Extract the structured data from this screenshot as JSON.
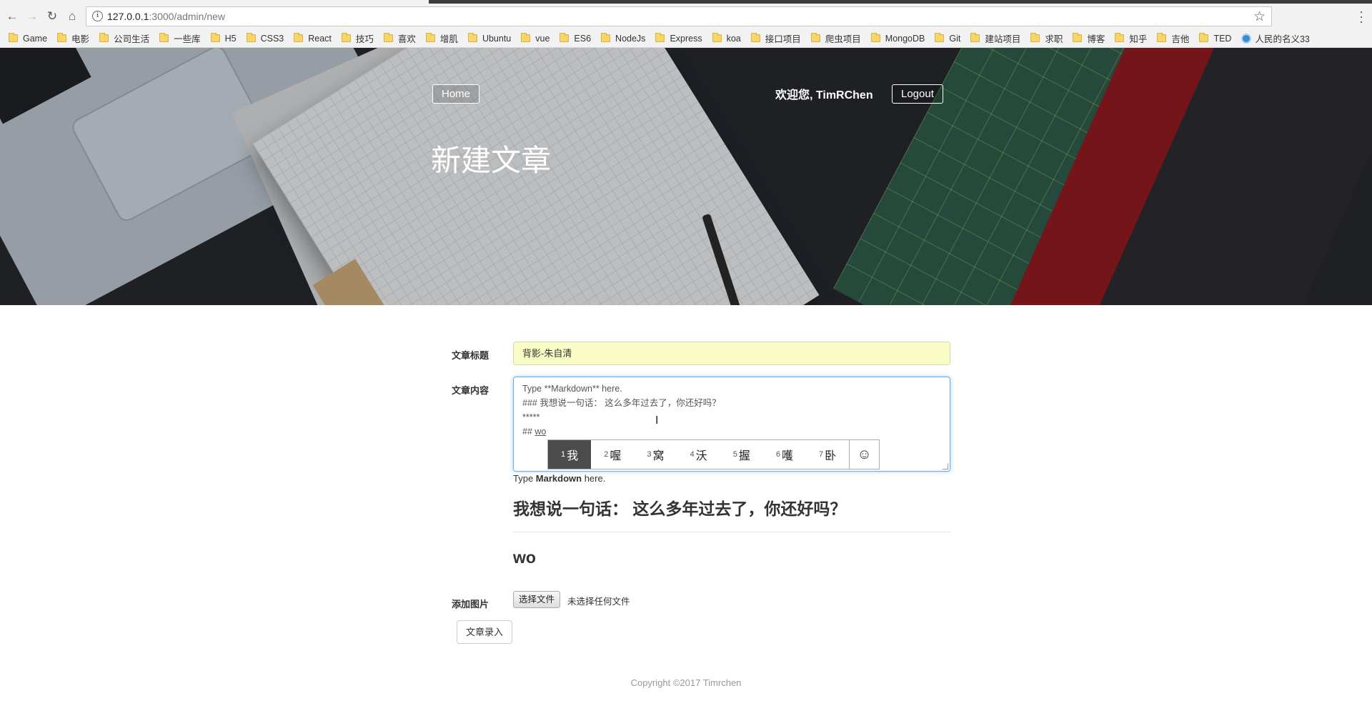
{
  "browser": {
    "url_host": "127.0.0.1",
    "url_path": ":3000/admin/new",
    "bookmarks": [
      "Game",
      "电影",
      "公司生活",
      "一些库",
      "H5",
      "CSS3",
      "React",
      "技巧",
      "喜欢",
      "增肌",
      "Ubuntu",
      "vue",
      "ES6",
      "NodeJs",
      "Express",
      "koa",
      "接口项目",
      "爬虫项目",
      "MongoDB",
      "Git",
      "建站项目",
      "求职",
      "博客",
      "知乎",
      "吉他",
      "TED"
    ],
    "last_bookmark": "人民的名义33"
  },
  "header": {
    "home_label": "Home",
    "welcome_text": "欢迎您, TimRChen",
    "logout_label": "Logout",
    "page_title": "新建文章"
  },
  "form": {
    "title_label": "文章标题",
    "title_value": "背影-朱自清",
    "content_label": "文章内容",
    "content_lines": [
      "Type **Markdown** here.",
      "### 我想说一句话： 这么多年过去了，你还好吗？",
      "*****"
    ],
    "content_last_prefix": "## ",
    "content_typing": "wo",
    "image_label": "添加图片",
    "file_button": "选择文件",
    "file_status": "未选择任何文件",
    "submit_label": "文章录入"
  },
  "ime": {
    "candidates": [
      {
        "num": "1",
        "char": "我"
      },
      {
        "num": "2",
        "char": "喔"
      },
      {
        "num": "3",
        "char": "窝"
      },
      {
        "num": "4",
        "char": "沃"
      },
      {
        "num": "5",
        "char": "握"
      },
      {
        "num": "6",
        "char": "嚄"
      },
      {
        "num": "7",
        "char": "卧"
      }
    ],
    "emoji_icon": "☺"
  },
  "preview": {
    "p_prefix": "Type ",
    "p_bold": "Markdown",
    "p_suffix": " here.",
    "h3": "我想说一句话： 这么多年过去了，你还好吗？",
    "h2": "wo"
  },
  "footer": {
    "copyright": "Copyright ©2017 Timrchen"
  }
}
